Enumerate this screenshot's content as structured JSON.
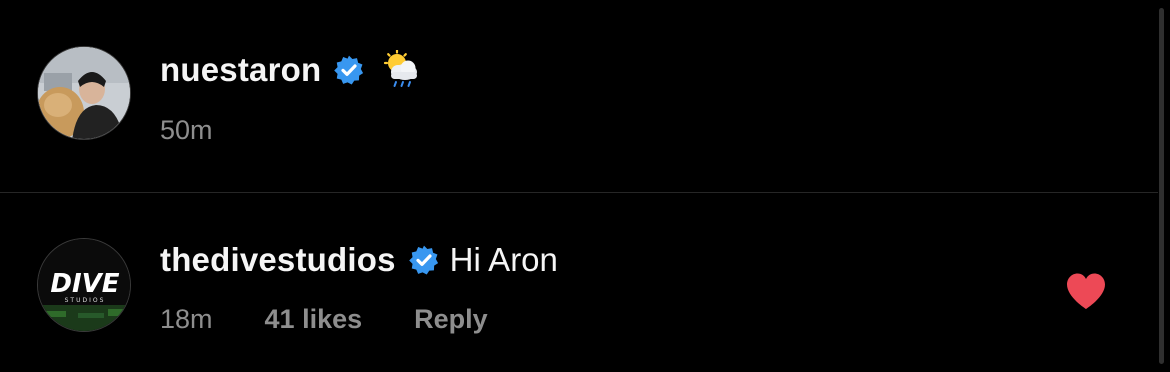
{
  "comments": [
    {
      "username": "nuestaron",
      "verified": true,
      "status_emoji": "sun-behind-rain-cloud",
      "text": "",
      "time": "50m"
    },
    {
      "username": "thedivestudios",
      "verified": true,
      "text": "Hi Aron",
      "time": "18m",
      "likes_label": "41 likes",
      "reply_label": "Reply",
      "liked": true,
      "avatar_logo_text": "DIVE",
      "avatar_logo_subtext": "STUDIOS"
    }
  ],
  "colors": {
    "background": "#000000",
    "text_primary": "#f5f5f5",
    "text_secondary": "#8e8e8e",
    "verified_badge": "#3897f0",
    "heart": "#ed4956",
    "divider": "#262626"
  }
}
